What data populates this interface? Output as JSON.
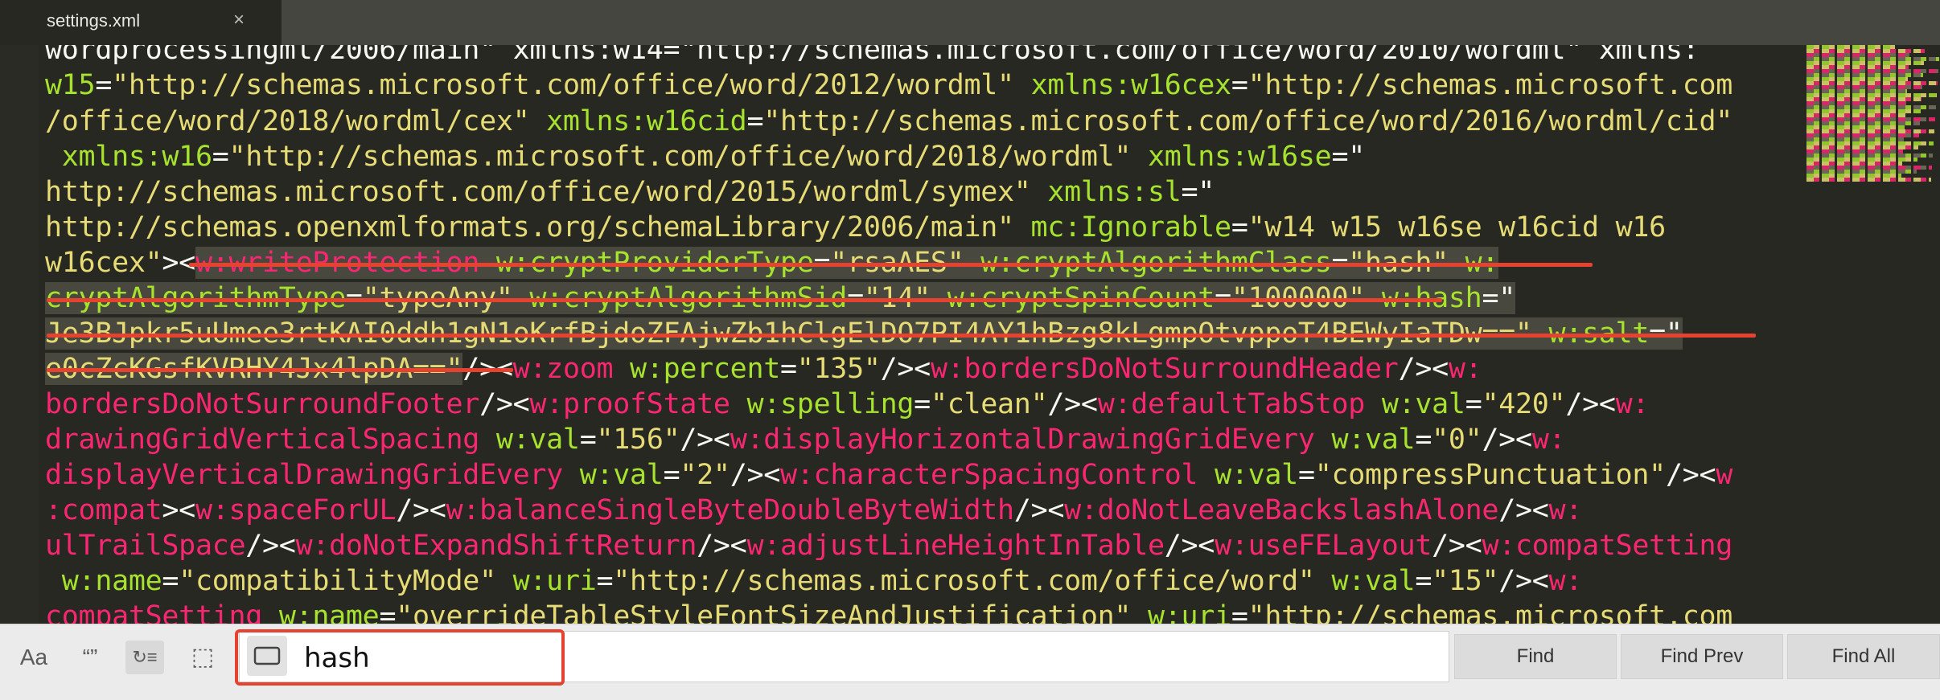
{
  "tab": {
    "title": "settings.xml",
    "close_icon": "×"
  },
  "code": {
    "lines": [
      [
        {
          "t": "wordprocessingml/2006/main\" xmlns:w14=\"http://schemas.microsoft.com/office/word/2010/wordml\" xmlns:",
          "c": "p"
        }
      ],
      [
        {
          "t": "w15",
          "c": "a"
        },
        {
          "t": "=",
          "c": "p"
        },
        {
          "t": "\"http://schemas.microsoft.com/office/word/2012/wordml\"",
          "c": "s"
        },
        {
          "t": " xmlns:w16cex",
          "c": "a"
        },
        {
          "t": "=",
          "c": "p"
        },
        {
          "t": "\"http://schemas.microsoft.com",
          "c": "s"
        }
      ],
      [
        {
          "t": "/office/word/2018/wordml/cex\"",
          "c": "s"
        },
        {
          "t": " xmlns:w16cid",
          "c": "a"
        },
        {
          "t": "=",
          "c": "p"
        },
        {
          "t": "\"http://schemas.microsoft.com/office/word/2016/wordml/cid\"",
          "c": "s"
        }
      ],
      [
        {
          "t": " xmlns:w16",
          "c": "a"
        },
        {
          "t": "=",
          "c": "p"
        },
        {
          "t": "\"http://schemas.microsoft.com/office/word/2018/wordml\"",
          "c": "s"
        },
        {
          "t": " xmlns:w16se",
          "c": "a"
        },
        {
          "t": "=\"",
          "c": "p"
        }
      ],
      [
        {
          "t": "http://schemas.microsoft.com/office/word/2015/wordml/symex\"",
          "c": "s"
        },
        {
          "t": " xmlns:sl",
          "c": "a"
        },
        {
          "t": "=\"",
          "c": "p"
        }
      ],
      [
        {
          "t": "http://schemas.openxmlformats.org/schemaLibrary/2006/main\"",
          "c": "s"
        },
        {
          "t": " mc:Ignorable",
          "c": "a"
        },
        {
          "t": "=",
          "c": "p"
        },
        {
          "t": "\"w14 w15 w16se w16cid w16",
          "c": "s"
        }
      ],
      [
        {
          "t": "w16cex\"",
          "c": "s"
        },
        {
          "t": "><",
          "c": "p"
        },
        {
          "t": "w:writeProtection",
          "c": "t",
          "sel": true
        },
        {
          "t": " w:cryptProviderType",
          "c": "a",
          "sel": true
        },
        {
          "t": "=",
          "c": "p",
          "sel": true
        },
        {
          "t": "\"rsaAES\"",
          "c": "s",
          "sel": true
        },
        {
          "t": " w:cryptAlgorithmClass",
          "c": "a",
          "sel": true
        },
        {
          "t": "=",
          "c": "p",
          "sel": true
        },
        {
          "t": "\"hash\"",
          "c": "s",
          "sel": true
        },
        {
          "t": " w:",
          "c": "a",
          "sel": true
        }
      ],
      [
        {
          "t": "cryptAlgorithmType",
          "c": "a",
          "sel": true
        },
        {
          "t": "=",
          "c": "p",
          "sel": true
        },
        {
          "t": "\"typeAny\"",
          "c": "s",
          "sel": true
        },
        {
          "t": " w:cryptAlgorithmSid",
          "c": "a",
          "sel": true
        },
        {
          "t": "=",
          "c": "p",
          "sel": true
        },
        {
          "t": "\"14\"",
          "c": "s",
          "sel": true
        },
        {
          "t": " w:cryptSpinCount",
          "c": "a",
          "sel": true
        },
        {
          "t": "=",
          "c": "p",
          "sel": true
        },
        {
          "t": "\"100000\"",
          "c": "s",
          "sel": true
        },
        {
          "t": " w:hash",
          "c": "a",
          "sel": true
        },
        {
          "t": "=\"",
          "c": "p",
          "sel": true
        }
      ],
      [
        {
          "t": "Je3BJpkr5uUmee3rtKAI0ddh1gN1oKrfBjdoZFAjwZb1hClgElDO7PI4AY1hBzg8kLgmpOtvppoT4BEWyIaTDw==\"",
          "c": "s",
          "sel": true
        },
        {
          "t": " w:salt",
          "c": "a",
          "sel": true
        },
        {
          "t": "=\"",
          "c": "p",
          "sel": true
        }
      ],
      [
        {
          "t": "e0cZcKGsfKVRHY4Jx4lpDA==\"",
          "c": "s",
          "sel": true
        },
        {
          "t": "/><",
          "c": "p"
        },
        {
          "t": "w:zoom",
          "c": "t"
        },
        {
          "t": " w:percent",
          "c": "a"
        },
        {
          "t": "=",
          "c": "p"
        },
        {
          "t": "\"135\"",
          "c": "s"
        },
        {
          "t": "/><",
          "c": "p"
        },
        {
          "t": "w:bordersDoNotSurroundHeader",
          "c": "t"
        },
        {
          "t": "/><",
          "c": "p"
        },
        {
          "t": "w:",
          "c": "t"
        }
      ],
      [
        {
          "t": "bordersDoNotSurroundFooter",
          "c": "t"
        },
        {
          "t": "/><",
          "c": "p"
        },
        {
          "t": "w:proofState",
          "c": "t"
        },
        {
          "t": " w:spelling",
          "c": "a"
        },
        {
          "t": "=",
          "c": "p"
        },
        {
          "t": "\"clean\"",
          "c": "s"
        },
        {
          "t": "/><",
          "c": "p"
        },
        {
          "t": "w:defaultTabStop",
          "c": "t"
        },
        {
          "t": " w:val",
          "c": "a"
        },
        {
          "t": "=",
          "c": "p"
        },
        {
          "t": "\"420\"",
          "c": "s"
        },
        {
          "t": "/><",
          "c": "p"
        },
        {
          "t": "w:",
          "c": "t"
        }
      ],
      [
        {
          "t": "drawingGridVerticalSpacing",
          "c": "t"
        },
        {
          "t": " w:val",
          "c": "a"
        },
        {
          "t": "=",
          "c": "p"
        },
        {
          "t": "\"156\"",
          "c": "s"
        },
        {
          "t": "/><",
          "c": "p"
        },
        {
          "t": "w:displayHorizontalDrawingGridEvery",
          "c": "t"
        },
        {
          "t": " w:val",
          "c": "a"
        },
        {
          "t": "=",
          "c": "p"
        },
        {
          "t": "\"0\"",
          "c": "s"
        },
        {
          "t": "/><",
          "c": "p"
        },
        {
          "t": "w:",
          "c": "t"
        }
      ],
      [
        {
          "t": "displayVerticalDrawingGridEvery",
          "c": "t"
        },
        {
          "t": " w:val",
          "c": "a"
        },
        {
          "t": "=",
          "c": "p"
        },
        {
          "t": "\"2\"",
          "c": "s"
        },
        {
          "t": "/><",
          "c": "p"
        },
        {
          "t": "w:characterSpacingControl",
          "c": "t"
        },
        {
          "t": " w:val",
          "c": "a"
        },
        {
          "t": "=",
          "c": "p"
        },
        {
          "t": "\"compressPunctuation\"",
          "c": "s"
        },
        {
          "t": "/><",
          "c": "p"
        },
        {
          "t": "w",
          "c": "t"
        }
      ],
      [
        {
          "t": ":compat",
          "c": "t"
        },
        {
          "t": "><",
          "c": "p"
        },
        {
          "t": "w:spaceForUL",
          "c": "t"
        },
        {
          "t": "/><",
          "c": "p"
        },
        {
          "t": "w:balanceSingleByteDoubleByteWidth",
          "c": "t"
        },
        {
          "t": "/><",
          "c": "p"
        },
        {
          "t": "w:doNotLeaveBackslashAlone",
          "c": "t"
        },
        {
          "t": "/><",
          "c": "p"
        },
        {
          "t": "w:",
          "c": "t"
        }
      ],
      [
        {
          "t": "ulTrailSpace",
          "c": "t"
        },
        {
          "t": "/><",
          "c": "p"
        },
        {
          "t": "w:doNotExpandShiftReturn",
          "c": "t"
        },
        {
          "t": "/><",
          "c": "p"
        },
        {
          "t": "w:adjustLineHeightInTable",
          "c": "t"
        },
        {
          "t": "/><",
          "c": "p"
        },
        {
          "t": "w:useFELayout",
          "c": "t"
        },
        {
          "t": "/><",
          "c": "p"
        },
        {
          "t": "w:compatSetting",
          "c": "t"
        }
      ],
      [
        {
          "t": " w:name",
          "c": "a"
        },
        {
          "t": "=",
          "c": "p"
        },
        {
          "t": "\"compatibilityMode\"",
          "c": "s"
        },
        {
          "t": " w:uri",
          "c": "a"
        },
        {
          "t": "=",
          "c": "p"
        },
        {
          "t": "\"http://schemas.microsoft.com/office/word\"",
          "c": "s"
        },
        {
          "t": " w:val",
          "c": "a"
        },
        {
          "t": "=",
          "c": "p"
        },
        {
          "t": "\"15\"",
          "c": "s"
        },
        {
          "t": "/><",
          "c": "p"
        },
        {
          "t": "w:",
          "c": "t"
        }
      ],
      [
        {
          "t": "compatSetting",
          "c": "t"
        },
        {
          "t": " w:name",
          "c": "a"
        },
        {
          "t": "=",
          "c": "p"
        },
        {
          "t": "\"overrideTableStyleFontSizeAndJustification\"",
          "c": "s"
        },
        {
          "t": " w:uri",
          "c": "a"
        },
        {
          "t": "=",
          "c": "p"
        },
        {
          "t": "\"http://schemas.microsoft.com",
          "c": "s"
        }
      ]
    ]
  },
  "find_bar": {
    "options": [
      {
        "name": "case-sensitive-toggle",
        "label": "Aa",
        "on": false
      },
      {
        "name": "whole-word-toggle",
        "label": "“”",
        "on": false
      },
      {
        "name": "wrap-toggle",
        "label": "↻≡",
        "on": true
      },
      {
        "name": "in-selection-toggle",
        "label": "⬚",
        "on": false
      }
    ],
    "query": "hash",
    "buttons": {
      "find": "Find",
      "find_prev": "Find Prev",
      "find_all": "Find All"
    }
  },
  "colors": {
    "highlight": "#e5422f",
    "tag": "#f92672",
    "attribute": "#a6e22e",
    "string": "#e6db74"
  }
}
